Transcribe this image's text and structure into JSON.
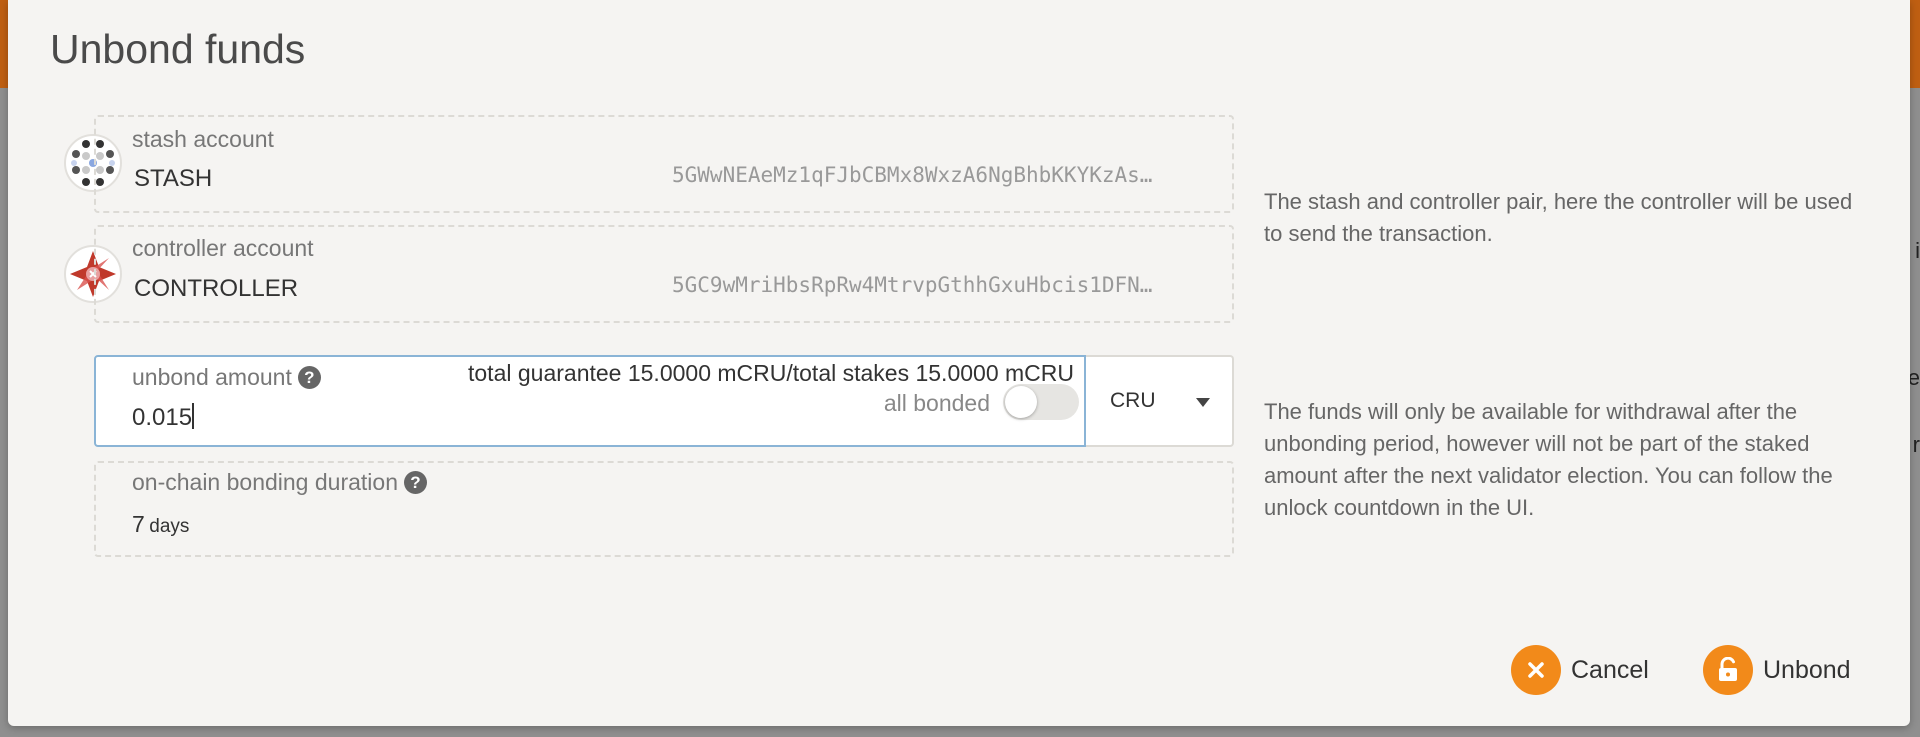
{
  "modal": {
    "title": "Unbond funds"
  },
  "stash": {
    "label": "stash account",
    "name": "STASH",
    "address": "5GWwNEAeMz1qFJbCBMx8WxzA6NgBhbKKYKzAs…"
  },
  "controller": {
    "label": "controller account",
    "name": "CONTROLLER",
    "address": "5GC9wMriHbsRpRw4MtrvpGthhGxuHbcis1DFN…"
  },
  "help": {
    "accounts": "The stash and controller pair, here the controller will be used to send the transaction.",
    "unbond": "The funds will only be available for withdrawal after the unbonding period, however will not be part of the staked amount after the next validator election. You can follow the unlock countdown in the UI."
  },
  "amount": {
    "label": "unbond amount",
    "summary": "total guarantee 15.0000 mCRU/total stakes 15.0000 mCRU",
    "value": "0.015",
    "toggle_label": "all bonded",
    "toggle_on": false,
    "unit": "CRU"
  },
  "duration": {
    "label": "on-chain bonding duration",
    "value": "7",
    "unit": "days"
  },
  "buttons": {
    "cancel": "Cancel",
    "unbond": "Unbond"
  },
  "colors": {
    "accent": "#f28a1a",
    "topbar": "#bf5f12",
    "focus_border": "#8ab4d6"
  },
  "icons": [
    "help-icon",
    "chevron-down-icon",
    "close-icon",
    "unlock-icon"
  ]
}
